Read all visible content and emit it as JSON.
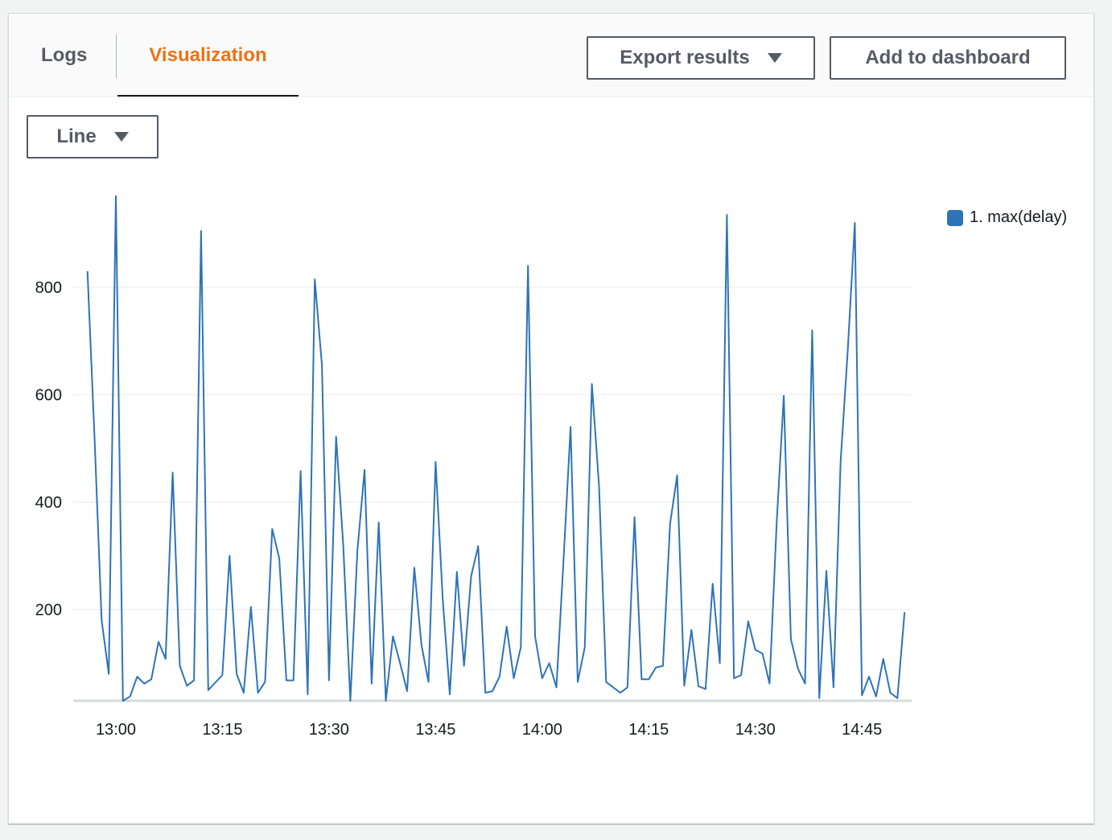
{
  "tabs": {
    "logs": "Logs",
    "visualization": "Visualization"
  },
  "toolbar": {
    "export_label": "Export results",
    "add_label": "Add to dashboard"
  },
  "chart_type_select": {
    "selected": "Line"
  },
  "colors": {
    "accent": "#ec7211",
    "series": "#2e73b8",
    "grid": "#e9ebed"
  },
  "chart_data": {
    "type": "line",
    "x_ticks": [
      "13:00",
      "13:15",
      "13:30",
      "13:45",
      "14:00",
      "14:15",
      "14:30",
      "14:45"
    ],
    "y_ticks": [
      200,
      400,
      600,
      800
    ],
    "ylim": [
      30,
      980
    ],
    "grid": true,
    "legend_position": "top-right",
    "series": [
      {
        "name": "1. max(delay)",
        "points": [
          [
            "12:56",
            830
          ],
          [
            "12:57",
            520
          ],
          [
            "12:58",
            180
          ],
          [
            "12:59",
            80
          ],
          [
            "13:00",
            970
          ],
          [
            "13:01",
            30
          ],
          [
            "13:02",
            38
          ],
          [
            "13:03",
            75
          ],
          [
            "13:04",
            62
          ],
          [
            "13:05",
            70
          ],
          [
            "13:06",
            140
          ],
          [
            "13:07",
            108
          ],
          [
            "13:08",
            455
          ],
          [
            "13:09",
            95
          ],
          [
            "13:10",
            58
          ],
          [
            "13:11",
            68
          ],
          [
            "13:12",
            905
          ],
          [
            "13:13",
            50
          ],
          [
            "13:15",
            78
          ],
          [
            "13:16",
            300
          ],
          [
            "13:17",
            80
          ],
          [
            "13:18",
            45
          ],
          [
            "13:19",
            205
          ],
          [
            "13:20",
            45
          ],
          [
            "13:21",
            65
          ],
          [
            "13:22",
            350
          ],
          [
            "13:23",
            295
          ],
          [
            "13:24",
            68
          ],
          [
            "13:25",
            68
          ],
          [
            "13:26",
            458
          ],
          [
            "13:27",
            42
          ],
          [
            "13:28",
            815
          ],
          [
            "13:29",
            655
          ],
          [
            "13:30",
            68
          ],
          [
            "13:31",
            522
          ],
          [
            "13:32",
            320
          ],
          [
            "13:33",
            30
          ],
          [
            "13:34",
            310
          ],
          [
            "13:35",
            460
          ],
          [
            "13:36",
            62
          ],
          [
            "13:37",
            362
          ],
          [
            "13:38",
            30
          ],
          [
            "13:39",
            150
          ],
          [
            "13:40",
            100
          ],
          [
            "13:41",
            48
          ],
          [
            "13:42",
            278
          ],
          [
            "13:43",
            135
          ],
          [
            "13:44",
            65
          ],
          [
            "13:45",
            475
          ],
          [
            "13:46",
            220
          ],
          [
            "13:47",
            42
          ],
          [
            "13:48",
            270
          ],
          [
            "13:49",
            95
          ],
          [
            "13:50",
            262
          ],
          [
            "13:51",
            318
          ],
          [
            "13:52",
            45
          ],
          [
            "13:53",
            48
          ],
          [
            "13:54",
            75
          ],
          [
            "13:55",
            168
          ],
          [
            "13:56",
            72
          ],
          [
            "13:57",
            130
          ],
          [
            "13:58",
            840
          ],
          [
            "13:59",
            150
          ],
          [
            "14:00",
            72
          ],
          [
            "14:01",
            100
          ],
          [
            "14:02",
            55
          ],
          [
            "14:03",
            290
          ],
          [
            "14:04",
            540
          ],
          [
            "14:05",
            65
          ],
          [
            "14:06",
            130
          ],
          [
            "14:07",
            620
          ],
          [
            "14:08",
            430
          ],
          [
            "14:09",
            65
          ],
          [
            "14:10",
            55
          ],
          [
            "14:11",
            45
          ],
          [
            "14:12",
            55
          ],
          [
            "14:13",
            372
          ],
          [
            "14:14",
            70
          ],
          [
            "14:15",
            70
          ],
          [
            "14:16",
            92
          ],
          [
            "14:17",
            95
          ],
          [
            "14:18",
            360
          ],
          [
            "14:19",
            450
          ],
          [
            "14:20",
            58
          ],
          [
            "14:21",
            162
          ],
          [
            "14:22",
            57
          ],
          [
            "14:23",
            52
          ],
          [
            "14:24",
            248
          ],
          [
            "14:25",
            100
          ],
          [
            "14:26",
            935
          ],
          [
            "14:27",
            72
          ],
          [
            "14:28",
            78
          ],
          [
            "14:29",
            178
          ],
          [
            "14:30",
            125
          ],
          [
            "14:31",
            118
          ],
          [
            "14:32",
            62
          ],
          [
            "14:33",
            360
          ],
          [
            "14:34",
            598
          ],
          [
            "14:35",
            145
          ],
          [
            "14:36",
            90
          ],
          [
            "14:37",
            62
          ],
          [
            "14:38",
            720
          ],
          [
            "14:39",
            35
          ],
          [
            "14:40",
            272
          ],
          [
            "14:41",
            55
          ],
          [
            "14:42",
            475
          ],
          [
            "14:43",
            680
          ],
          [
            "14:44",
            920
          ],
          [
            "14:45",
            40
          ],
          [
            "14:46",
            75
          ],
          [
            "14:47",
            38
          ],
          [
            "14:48",
            108
          ],
          [
            "14:49",
            45
          ],
          [
            "14:50",
            35
          ],
          [
            "14:51",
            195
          ]
        ]
      }
    ]
  }
}
